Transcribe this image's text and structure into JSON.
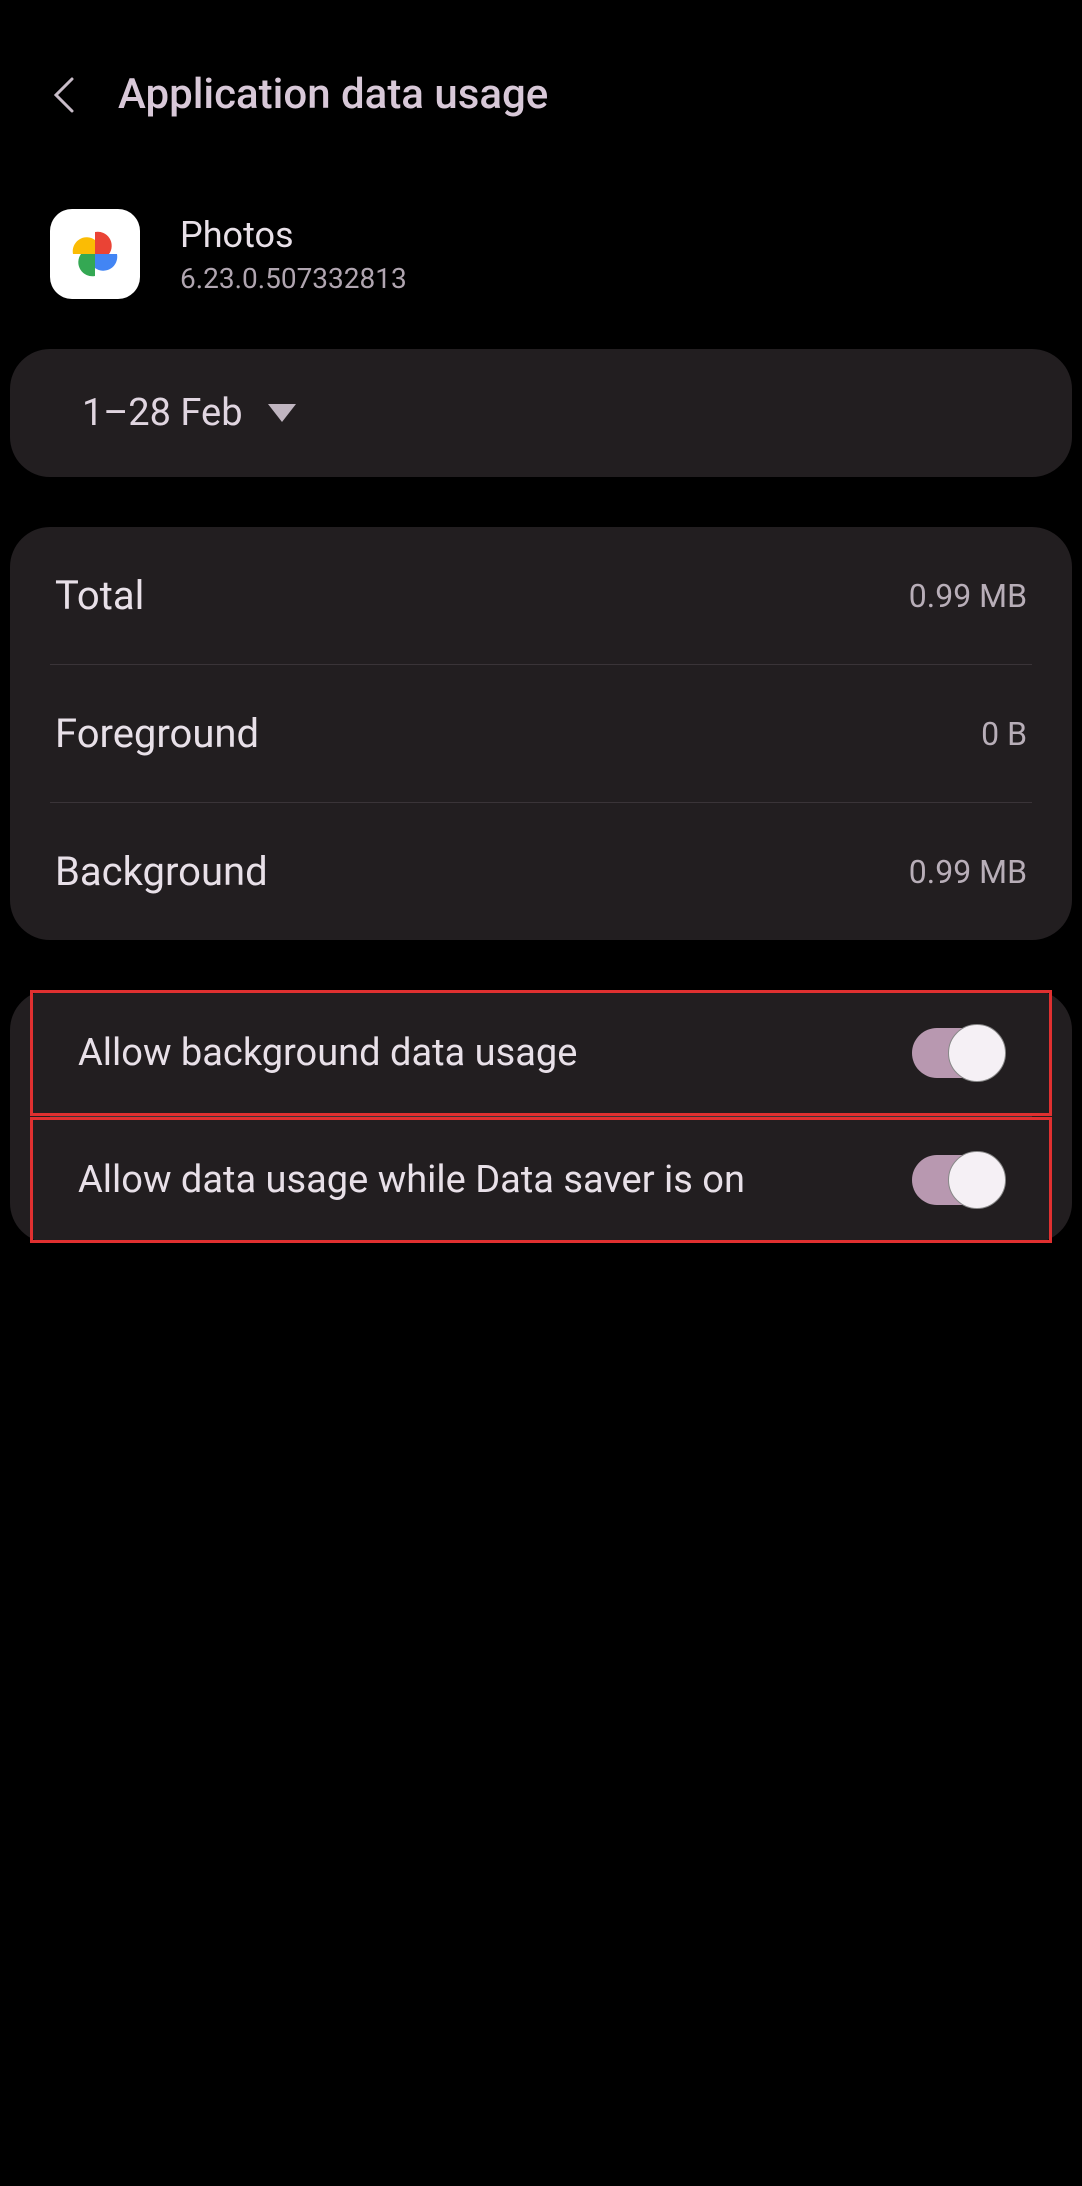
{
  "header": {
    "title": "Application data usage"
  },
  "app": {
    "name": "Photos",
    "version": "6.23.0.507332813"
  },
  "dateRange": {
    "label": "1–28 Feb"
  },
  "stats": {
    "total": {
      "label": "Total",
      "value": "0.99 MB"
    },
    "foreground": {
      "label": "Foreground",
      "value": "0 B"
    },
    "background": {
      "label": "Background",
      "value": "0.99 MB"
    }
  },
  "toggles": {
    "backgroundData": {
      "label": "Allow background data usage",
      "enabled": true
    },
    "dataSaver": {
      "label": "Allow data usage while Data saver is on",
      "enabled": true
    }
  }
}
